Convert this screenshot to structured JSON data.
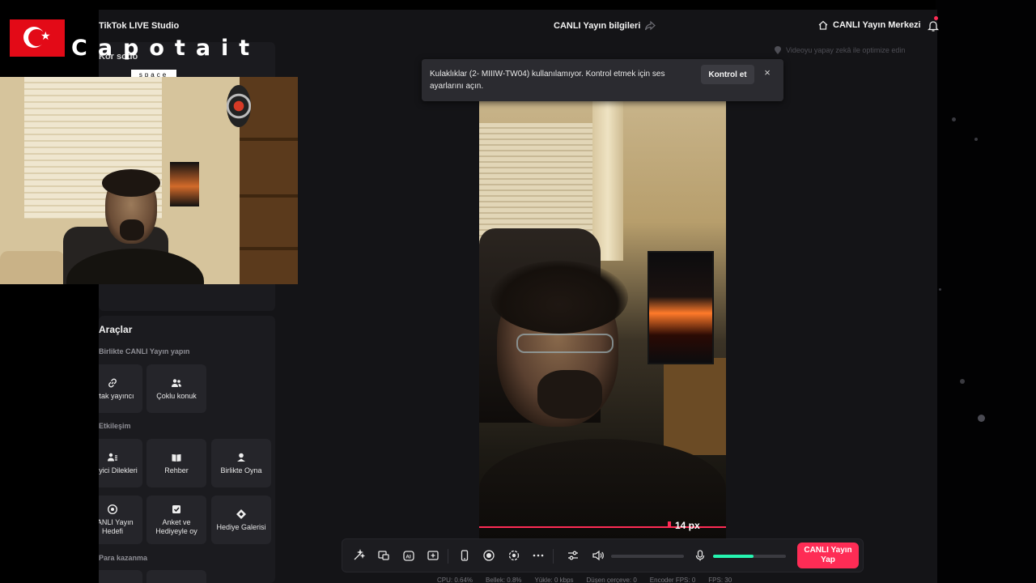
{
  "app": {
    "title": "TikTok LIVE Studio",
    "center_title": "CANLI Yayın bilgileri",
    "live_center_label": "CANLI Yayın Merkezi",
    "optimize_hint": "Videoyu yapay zekâ ile optimize edin"
  },
  "left_panel": {
    "top_label": "Kör sodo",
    "tools_heading": "Araçlar",
    "groups": [
      {
        "heading": "Birlikte CANLI Yayın yapın",
        "items": [
          {
            "label": "Ortak yayıncı",
            "icon": "link-icon"
          },
          {
            "label": "Çoklu konuk",
            "icon": "users-icon"
          }
        ]
      },
      {
        "heading": "Etkileşim",
        "items": [
          {
            "label": "İzleyici Dilekleri",
            "icon": "user-list-icon"
          },
          {
            "label": "Rehber",
            "icon": "book-icon"
          },
          {
            "label": "Birlikte Oyna",
            "icon": "gamepad-icon"
          },
          {
            "label": "CANLI Yayın Hedefi",
            "icon": "target-icon"
          },
          {
            "label": "Anket ve Hediyeyle oy",
            "icon": "poll-icon"
          },
          {
            "label": "Hediye Galerisi",
            "icon": "gift-icon"
          }
        ]
      },
      {
        "heading": "Para kazanma",
        "items": []
      }
    ]
  },
  "toast": {
    "message": "Kulaklıklar (2- MIIIW-TW04) kullanılamıyor. Kontrol etmek için ses ayarlarını açın.",
    "action_label": "Kontrol et",
    "close_glyph": "×"
  },
  "preview": {
    "overlay_text": "14 px"
  },
  "controls": {
    "go_live_label": "CANLI Yayın Yap",
    "volume_level": 0.0,
    "mic_level": 0.55,
    "icons": [
      "magic-wand-icon",
      "screen-share-icon",
      "ai-icon",
      "add-source-icon",
      "phone-icon",
      "record-icon",
      "camera-effect-icon",
      "more-icon",
      "adjust-icon",
      "speaker-icon",
      "microphone-icon"
    ]
  },
  "stats": {
    "cpu": "CPU: 0.64%",
    "memory": "Bellek: 0.8%",
    "upload": "Yükle: 0 kbps",
    "dropped": "Düşen çerçeve: 0",
    "encoder_fps": "Encoder FPS: 0",
    "fps": "FPS: 30"
  },
  "overlay": {
    "brand": "Capotait",
    "brand_sub": "space"
  },
  "colors": {
    "accent": "#fe2c55",
    "mic_meter": "#25f4b0",
    "panel_bg": "#1b1b1f",
    "app_bg": "#141417"
  }
}
